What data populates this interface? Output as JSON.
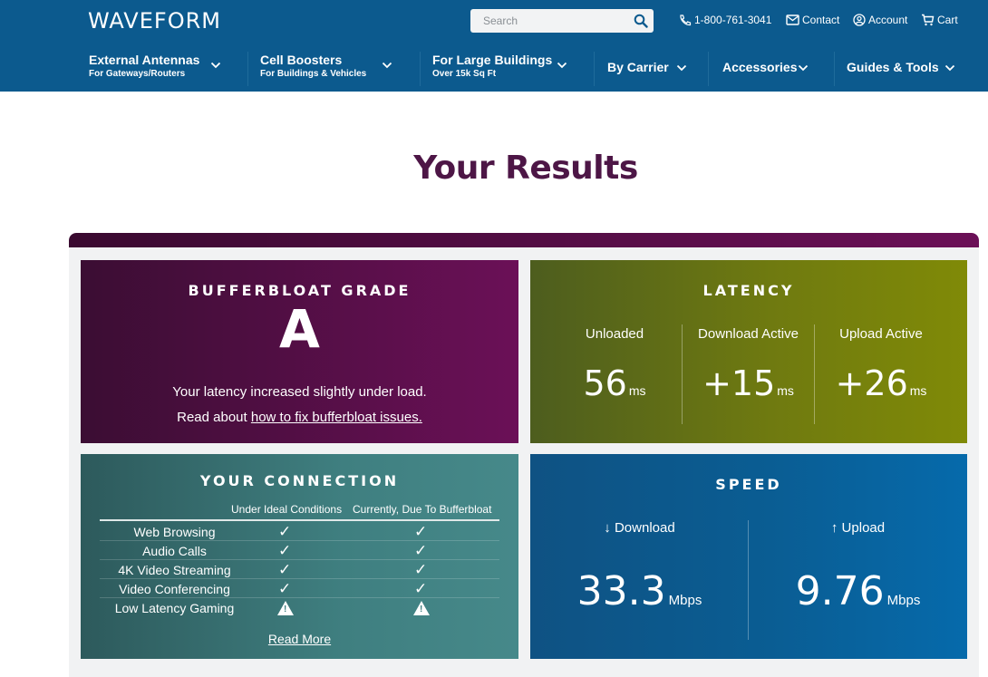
{
  "header": {
    "logo": "WAVEFORM",
    "search": {
      "placeholder": "Search"
    },
    "phone": "1-800-761-3041",
    "contact": "Contact",
    "account": "Account",
    "cart": "Cart",
    "nav": [
      {
        "title": "External Antennas",
        "sub": "For Gateways/Routers"
      },
      {
        "title": "Cell Boosters",
        "sub": "For Buildings & Vehicles"
      },
      {
        "title": "For Large Buildings",
        "sub": "Over 15k Sq Ft"
      },
      {
        "title": "By Carrier",
        "sub": ""
      },
      {
        "title": "Accessories",
        "sub": ""
      },
      {
        "title": "Guides & Tools",
        "sub": ""
      }
    ]
  },
  "page": {
    "title": "Your Results"
  },
  "bufferbloat": {
    "title": "BUFFERBLOAT GRADE",
    "grade": "A",
    "message": "Your latency increased slightly under load.",
    "read_prefix": "Read about",
    "link_text": "how to fix bufferbloat issues."
  },
  "latency": {
    "title": "LATENCY",
    "columns": [
      {
        "label": "Unloaded",
        "value": "56",
        "unit": "ms"
      },
      {
        "label": "Download Active",
        "value": "+15",
        "unit": "ms"
      },
      {
        "label": "Upload Active",
        "value": "+26",
        "unit": "ms"
      }
    ]
  },
  "connection": {
    "title": "YOUR CONNECTION",
    "headers": [
      "Under Ideal Conditions",
      "Currently, Due To Bufferbloat"
    ],
    "rows": [
      {
        "label": "Web Browsing",
        "ideal": "check",
        "current": "check"
      },
      {
        "label": "Audio Calls",
        "ideal": "check",
        "current": "check"
      },
      {
        "label": "4K Video Streaming",
        "ideal": "check",
        "current": "check"
      },
      {
        "label": "Video Conferencing",
        "ideal": "check",
        "current": "check"
      },
      {
        "label": "Low Latency Gaming",
        "ideal": "warning",
        "current": "warning"
      }
    ],
    "read_more": "Read More"
  },
  "speed": {
    "title": "SPEED",
    "download": {
      "label": "↓ Download",
      "value": "33.3",
      "unit": "Mbps"
    },
    "upload": {
      "label": "↑ Upload",
      "value": "9.76",
      "unit": "Mbps"
    }
  },
  "colors": {
    "header": "#0c5a8e",
    "title": "#4d1646",
    "bufferbloat": "#6b1057",
    "latency": "#808a07",
    "connection": "#3f7f80",
    "speed": "#066aab"
  }
}
